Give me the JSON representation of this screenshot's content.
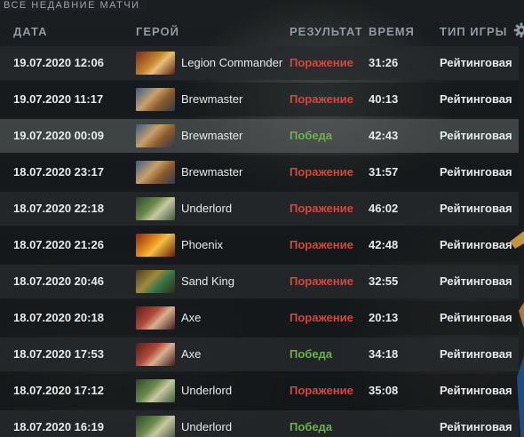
{
  "section_title": "ВСЕ НЕДАВНИЕ МАТЧИ",
  "columns": {
    "date": "ДАТА",
    "hero": "ГЕРОЙ",
    "result": "РЕЗУЛЬТАТ",
    "duration": "ВРЕМЯ",
    "game_type": "ТИП ИГРЫ"
  },
  "icons": {
    "settings": "gear-icon"
  },
  "colors": {
    "loss": "#d4473a",
    "win": "#6cb24a",
    "header_text": "#8e9ba3"
  },
  "matches": [
    {
      "date": "19.07.2020 12:06",
      "hero": "Legion Commander",
      "result": "Поражение",
      "outcome": "loss",
      "duration": "31:26",
      "game_type": "Рейтинговая",
      "portrait": "legion-commander-portrait"
    },
    {
      "date": "19.07.2020 11:17",
      "hero": "Brewmaster",
      "result": "Поражение",
      "outcome": "loss",
      "duration": "40:13",
      "game_type": "Рейтинговая",
      "portrait": "brewmaster-portrait"
    },
    {
      "date": "19.07.2020 00:09",
      "hero": "Brewmaster",
      "result": "Победа",
      "outcome": "win",
      "duration": "42:43",
      "game_type": "Рейтинговая",
      "portrait": "brewmaster-portrait"
    },
    {
      "date": "18.07.2020 23:17",
      "hero": "Brewmaster",
      "result": "Поражение",
      "outcome": "loss",
      "duration": "31:57",
      "game_type": "Рейтинговая",
      "portrait": "brewmaster-portrait"
    },
    {
      "date": "18.07.2020 22:18",
      "hero": "Underlord",
      "result": "Поражение",
      "outcome": "loss",
      "duration": "46:02",
      "game_type": "Рейтинговая",
      "portrait": "underlord-portrait"
    },
    {
      "date": "18.07.2020 21:26",
      "hero": "Phoenix",
      "result": "Поражение",
      "outcome": "loss",
      "duration": "42:48",
      "game_type": "Рейтинговая",
      "portrait": "phoenix-portrait"
    },
    {
      "date": "18.07.2020 20:46",
      "hero": "Sand King",
      "result": "Поражение",
      "outcome": "loss",
      "duration": "32:55",
      "game_type": "Рейтинговая",
      "portrait": "sand-king-portrait"
    },
    {
      "date": "18.07.2020 20:18",
      "hero": "Axe",
      "result": "Поражение",
      "outcome": "loss",
      "duration": "20:13",
      "game_type": "Рейтинговая",
      "portrait": "axe-portrait"
    },
    {
      "date": "18.07.2020 17:53",
      "hero": "Axe",
      "result": "Победа",
      "outcome": "win",
      "duration": "34:18",
      "game_type": "Рейтинговая",
      "portrait": "axe-portrait"
    },
    {
      "date": "18.07.2020 17:12",
      "hero": "Underlord",
      "result": "Поражение",
      "outcome": "loss",
      "duration": "35:08",
      "game_type": "Рейтинговая",
      "portrait": "underlord-portrait"
    },
    {
      "date": "18.07.2020 16:19",
      "hero": "Underlord",
      "result": "Победа",
      "outcome": "win",
      "duration": "",
      "game_type": "Рейтинговая",
      "portrait": "underlord-portrait"
    }
  ]
}
